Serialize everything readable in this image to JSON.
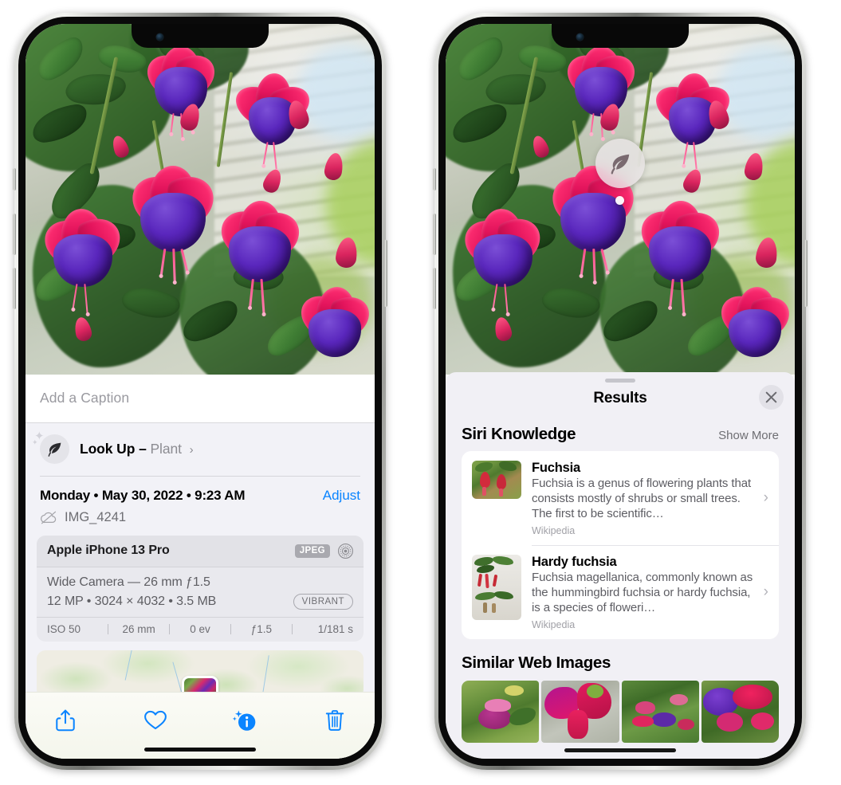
{
  "left_phone": {
    "name": "iPhone photo info view",
    "photo": {
      "alt": "Fuchsia flowers hanging basket",
      "subject": "Fuchsia"
    },
    "caption_field": {
      "placeholder": "Add a Caption",
      "value": ""
    },
    "look_up": {
      "label": "Look Up",
      "dash": "–",
      "kind": "Plant",
      "chevron": "›",
      "icon": "leaf-icon"
    },
    "metadata": {
      "date_line": "Monday • May 30, 2022 • 9:23 AM",
      "adjust_label": "Adjust",
      "file_name": "IMG_4241",
      "cloud_icon": "cloud-slash-icon"
    },
    "camera_card": {
      "model": "Apple iPhone 13 Pro",
      "format_badge": "JPEG",
      "aperture_icon": "aperture-icon",
      "lens_line": "Wide Camera — 26 mm ƒ1.5",
      "size_line": "12 MP • 3024 × 4032 • 3.5 MB",
      "style_badge": "VIBRANT",
      "exif": [
        "ISO 50",
        "26 mm",
        "0 ev",
        "ƒ1.5",
        "1/181 s"
      ]
    },
    "map": {
      "pin_label": "photo-pin"
    },
    "toolbar": [
      {
        "name": "share-button",
        "icon": "share-icon"
      },
      {
        "name": "favorite-button",
        "icon": "heart-icon"
      },
      {
        "name": "info-button",
        "icon": "info-sparkle-icon"
      },
      {
        "name": "delete-button",
        "icon": "trash-icon"
      }
    ]
  },
  "right_phone": {
    "name": "Visual Look Up results view",
    "badge": {
      "icon": "leaf-icon",
      "label": "Look Up plant badge"
    },
    "sheet": {
      "grabber": "drag-handle",
      "title": "Results",
      "close_icon": "close-icon"
    },
    "siri_knowledge": {
      "title": "Siri Knowledge",
      "show_more": "Show More",
      "results": [
        {
          "title": "Fuchsia",
          "description": "Fuchsia is a genus of flowering plants that consists mostly of shrubs or small trees. The first to be scientific…",
          "source": "Wikipedia",
          "chevron": "›",
          "thumb": "fuchsia-thumbnail"
        },
        {
          "title": "Hardy fuchsia",
          "description": "Fuchsia magellanica, commonly known as the hummingbird fuchsia or hardy fuchsia, is a species of floweri…",
          "source": "Wikipedia",
          "chevron": "›",
          "thumb": "hardy-fuchsia-thumbnail"
        }
      ]
    },
    "similar_web_images": {
      "title": "Similar Web Images",
      "thumbs": [
        "web-image-1",
        "web-image-2",
        "web-image-3",
        "web-image-4"
      ]
    }
  },
  "colors": {
    "accent_blue": "#0a84ff",
    "sheet_gray": "#F1F0F5",
    "card_white": "#ffffff",
    "label_gray": "#6e6e73",
    "fuchsia_pink": "#e3145c",
    "fuchsia_purple": "#5a27bd"
  }
}
